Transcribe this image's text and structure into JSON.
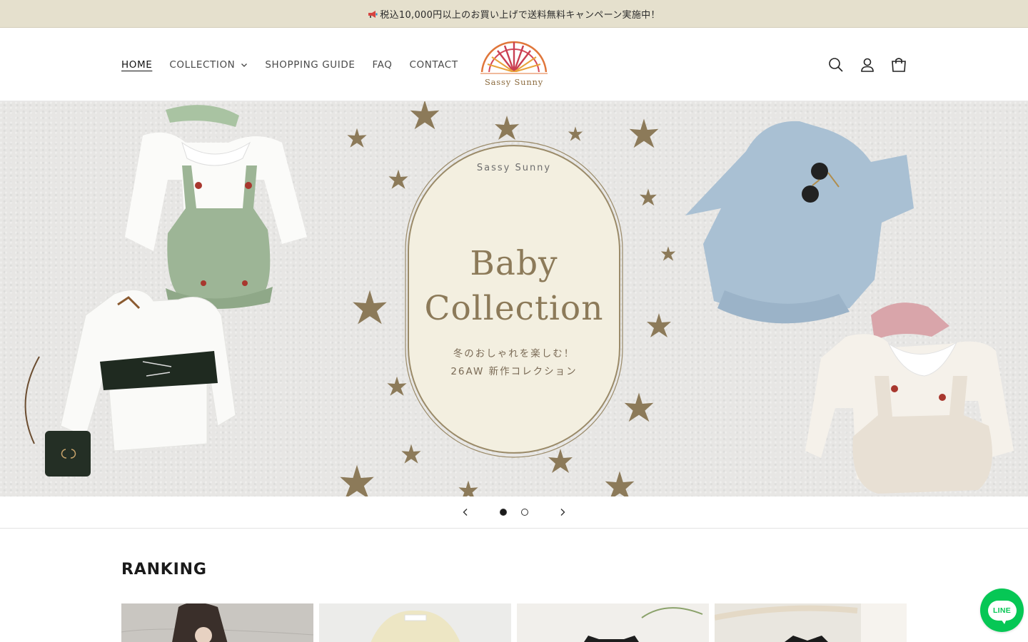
{
  "announcement": {
    "icon": "megaphone-icon",
    "text": "税込10,000円以上のお買い上げで送料無料キャンペーン実施中！"
  },
  "nav": {
    "items": [
      {
        "label": "HOME",
        "active": true
      },
      {
        "label": "COLLECTION",
        "has_dropdown": true
      },
      {
        "label": "SHOPPING GUIDE"
      },
      {
        "label": "FAQ"
      },
      {
        "label": "CONTACT"
      }
    ]
  },
  "logo": {
    "text": "Sassy Sunny"
  },
  "header_icons": [
    "search-icon",
    "account-icon",
    "cart-icon"
  ],
  "hero": {
    "brand": "Sassy Sunny",
    "title_line1": "Baby",
    "title_line2": "Collection",
    "subtitle_line1": "冬のおしゃれを楽しむ！",
    "subtitle_line2": "26AW 新作コレクション",
    "slide_count": 2,
    "active_slide": 1
  },
  "ranking": {
    "title": "RANKING",
    "product_count": 4
  },
  "line_button": {
    "label": "LINE"
  },
  "colors": {
    "announcement_bg": "#e5e0cd",
    "hero_bg": "#e7e6e4",
    "gold": "#8c7a59",
    "line_green": "#06c755"
  }
}
